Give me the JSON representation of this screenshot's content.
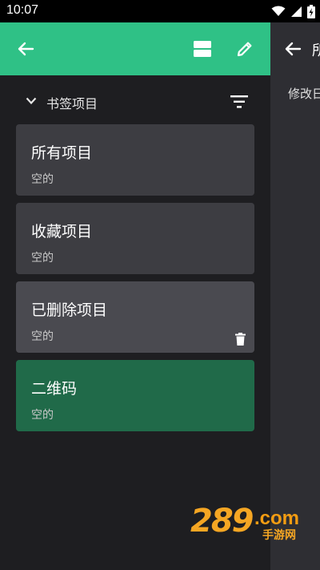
{
  "status_bar": {
    "time": "10:07"
  },
  "appbar": {
    "back_icon": "arrow-left-icon",
    "view_toggle_icon": "view-agenda-icon",
    "edit_icon": "pencil-icon",
    "color": "#2fc186"
  },
  "section": {
    "title": "书签项目",
    "filter_icon": "filter-icon"
  },
  "cards": [
    {
      "title": "所有项目",
      "subtitle": "空的"
    },
    {
      "title": "收藏项目",
      "subtitle": "空的"
    },
    {
      "title": "已删除项目",
      "subtitle": "空的",
      "action_icon": "trash-icon"
    },
    {
      "title": "二维码",
      "subtitle": "空的"
    }
  ],
  "right_pane": {
    "title_partial": "所",
    "label_partial": "修改日"
  },
  "watermark": {
    "brand": "289",
    "domain": ".com",
    "tagline": "手游网"
  }
}
